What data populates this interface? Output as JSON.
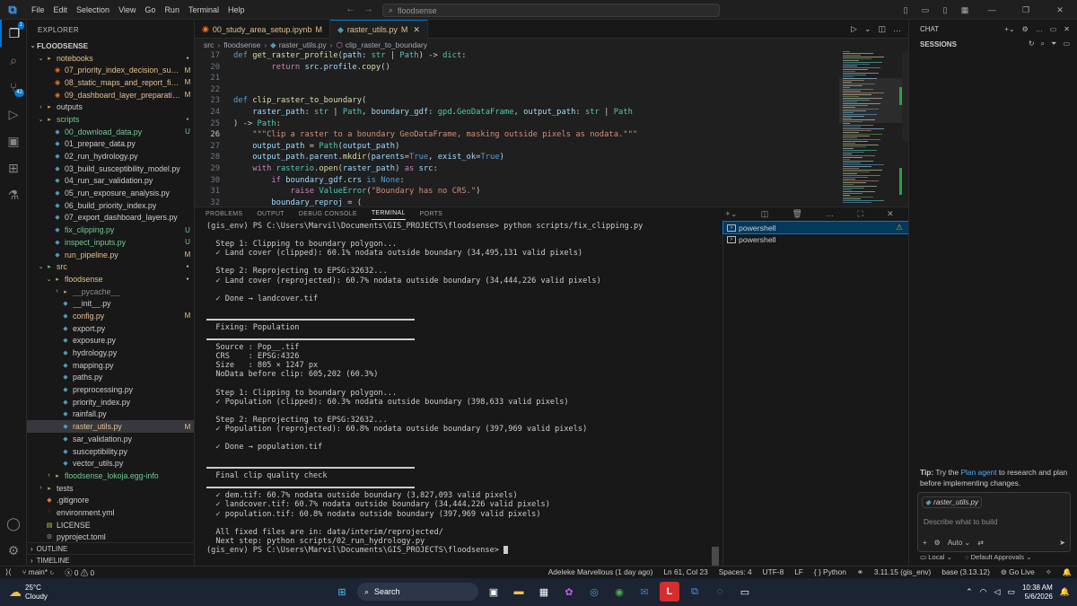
{
  "titlebar": {
    "menu": [
      "File",
      "Edit",
      "Selection",
      "View",
      "Go",
      "Run",
      "Terminal",
      "Help"
    ],
    "search_placeholder": "floodsense"
  },
  "explorer": {
    "header": "EXPLORER",
    "root": "FLOODSENSE",
    "items": [
      {
        "depth": 1,
        "chev": "⌄",
        "icon": "folder",
        "label": "notebooks",
        "status": "",
        "cls": "c-mod",
        "dot": true
      },
      {
        "depth": 2,
        "chev": "",
        "icon": "nb",
        "label": "07_priority_index_decision_suppor...",
        "status": "M",
        "cls": "c-mod"
      },
      {
        "depth": 2,
        "chev": "",
        "icon": "nb",
        "label": "08_static_maps_and_report_figure...",
        "status": "M",
        "cls": "c-mod"
      },
      {
        "depth": 2,
        "chev": "",
        "icon": "nb",
        "label": "09_dashboard_layer_preparation.i...",
        "status": "M",
        "cls": "c-mod"
      },
      {
        "depth": 1,
        "chev": "›",
        "icon": "folder",
        "label": "outputs",
        "status": "",
        "cls": "c-def"
      },
      {
        "depth": 1,
        "chev": "⌄",
        "icon": "folder",
        "label": "scripts",
        "status": "",
        "cls": "c-new",
        "dot": true
      },
      {
        "depth": 2,
        "chev": "",
        "icon": "py",
        "label": "00_download_data.py",
        "status": "U",
        "cls": "c-new"
      },
      {
        "depth": 2,
        "chev": "",
        "icon": "py",
        "label": "01_prepare_data.py",
        "status": "",
        "cls": "c-def"
      },
      {
        "depth": 2,
        "chev": "",
        "icon": "py",
        "label": "02_run_hydrology.py",
        "status": "",
        "cls": "c-def"
      },
      {
        "depth": 2,
        "chev": "",
        "icon": "py",
        "label": "03_build_susceptibility_model.py",
        "status": "",
        "cls": "c-def"
      },
      {
        "depth": 2,
        "chev": "",
        "icon": "py",
        "label": "04_run_sar_validation.py",
        "status": "",
        "cls": "c-def"
      },
      {
        "depth": 2,
        "chev": "",
        "icon": "py",
        "label": "05_run_exposure_analysis.py",
        "status": "",
        "cls": "c-def"
      },
      {
        "depth": 2,
        "chev": "",
        "icon": "py",
        "label": "06_build_priority_index.py",
        "status": "",
        "cls": "c-def"
      },
      {
        "depth": 2,
        "chev": "",
        "icon": "py",
        "label": "07_export_dashboard_layers.py",
        "status": "",
        "cls": "c-def"
      },
      {
        "depth": 2,
        "chev": "",
        "icon": "py",
        "label": "fix_clipping.py",
        "status": "U",
        "cls": "c-new"
      },
      {
        "depth": 2,
        "chev": "",
        "icon": "py",
        "label": "inspect_inputs.py",
        "status": "U",
        "cls": "c-new"
      },
      {
        "depth": 2,
        "chev": "",
        "icon": "py",
        "label": "run_pipeline.py",
        "status": "M",
        "cls": "c-mod"
      },
      {
        "depth": 1,
        "chev": "⌄",
        "icon": "src",
        "label": "src",
        "status": "",
        "cls": "c-mod",
        "dot": true
      },
      {
        "depth": 2,
        "chev": "⌄",
        "icon": "folder",
        "label": "floodsense",
        "status": "",
        "cls": "c-mod",
        "dot": true
      },
      {
        "depth": 3,
        "chev": "›",
        "icon": "folder",
        "label": "__pycache__",
        "status": "",
        "cls": "c-dim"
      },
      {
        "depth": 3,
        "chev": "",
        "icon": "py",
        "label": "__init__.py",
        "status": "",
        "cls": "c-def"
      },
      {
        "depth": 3,
        "chev": "",
        "icon": "py",
        "label": "config.py",
        "status": "M",
        "cls": "c-mod"
      },
      {
        "depth": 3,
        "chev": "",
        "icon": "py",
        "label": "export.py",
        "status": "",
        "cls": "c-def"
      },
      {
        "depth": 3,
        "chev": "",
        "icon": "py",
        "label": "exposure.py",
        "status": "",
        "cls": "c-def"
      },
      {
        "depth": 3,
        "chev": "",
        "icon": "py",
        "label": "hydrology.py",
        "status": "",
        "cls": "c-def"
      },
      {
        "depth": 3,
        "chev": "",
        "icon": "py",
        "label": "mapping.py",
        "status": "",
        "cls": "c-def"
      },
      {
        "depth": 3,
        "chev": "",
        "icon": "py",
        "label": "paths.py",
        "status": "",
        "cls": "c-def"
      },
      {
        "depth": 3,
        "chev": "",
        "icon": "py",
        "label": "preprocessing.py",
        "status": "",
        "cls": "c-def"
      },
      {
        "depth": 3,
        "chev": "",
        "icon": "py",
        "label": "priority_index.py",
        "status": "",
        "cls": "c-def"
      },
      {
        "depth": 3,
        "chev": "",
        "icon": "py",
        "label": "rainfall.py",
        "status": "",
        "cls": "c-def"
      },
      {
        "depth": 3,
        "chev": "",
        "icon": "py",
        "label": "raster_utils.py",
        "status": "M",
        "cls": "c-mod",
        "sel": true
      },
      {
        "depth": 3,
        "chev": "",
        "icon": "py",
        "label": "sar_validation.py",
        "status": "",
        "cls": "c-def"
      },
      {
        "depth": 3,
        "chev": "",
        "icon": "py",
        "label": "susceptibility.py",
        "status": "",
        "cls": "c-def"
      },
      {
        "depth": 3,
        "chev": "",
        "icon": "py",
        "label": "vector_utils.py",
        "status": "",
        "cls": "c-def"
      },
      {
        "depth": 2,
        "chev": "›",
        "icon": "folder",
        "label": "floodsense_lokoja.egg-info",
        "status": "",
        "cls": "c-new"
      },
      {
        "depth": 1,
        "chev": "›",
        "icon": "folder",
        "label": "tests",
        "status": "",
        "cls": "c-def"
      },
      {
        "depth": 1,
        "chev": "",
        "icon": "git",
        "label": ".gitignore",
        "status": "",
        "cls": "c-def"
      },
      {
        "depth": 1,
        "chev": "",
        "icon": "yml",
        "label": "environment.yml",
        "status": "",
        "cls": "c-def"
      },
      {
        "depth": 1,
        "chev": "",
        "icon": "lic",
        "label": "LICENSE",
        "status": "",
        "cls": "c-def"
      },
      {
        "depth": 1,
        "chev": "",
        "icon": "toml",
        "label": "pyproject.toml",
        "status": "",
        "cls": "c-def"
      }
    ],
    "outline": "OUTLINE",
    "timeline": "TIMELINE"
  },
  "editor": {
    "tabs": [
      {
        "label": "00_study_area_setup.ipynb",
        "mod": "M",
        "active": false
      },
      {
        "label": "raster_utils.py",
        "mod": "M",
        "active": true
      }
    ],
    "breadcrumb": [
      "src",
      "floodsense",
      "raster_utils.py",
      "clip_raster_to_boundary"
    ],
    "lines": [
      {
        "n": "17",
        "html": "<span class='kw'>def</span> <span class='fn'>get_raster_profile</span><span class='pl'>(</span><span class='var'>path</span><span class='pl'>: </span><span class='ty'>str</span><span class='pl'> | </span><span class='ty'>Path</span><span class='pl'>) -&gt; </span><span class='ty'>dict</span><span class='pl'>:</span>"
      },
      {
        "n": "20",
        "html": "        <span class='kw2'>return</span> <span class='var'>src</span><span class='pl'>.</span><span class='var'>profile</span><span class='pl'>.</span><span class='fn'>copy</span><span class='pl'>()</span>"
      },
      {
        "n": "21",
        "html": ""
      },
      {
        "n": "22",
        "html": ""
      },
      {
        "n": "23",
        "html": "<span class='kw'>def</span> <span class='fn'>clip_raster_to_boundary</span><span class='pl'>(</span>"
      },
      {
        "n": "24",
        "html": "    <span class='var'>raster_path</span><span class='pl'>: </span><span class='ty'>str</span><span class='pl'> | </span><span class='ty'>Path</span><span class='pl'>, </span><span class='var'>boundary_gdf</span><span class='pl'>: </span><span class='ty'>gpd</span><span class='pl'>.</span><span class='ty'>GeoDataFrame</span><span class='pl'>, </span><span class='var'>output_path</span><span class='pl'>: </span><span class='ty'>str</span><span class='pl'> | </span><span class='ty'>Path</span>"
      },
      {
        "n": "25",
        "html": "<span class='pl'>) -&gt; </span><span class='ty'>Path</span><span class='pl'>:</span>"
      },
      {
        "n": "26",
        "html": "    <span class='str'>\"\"\"Clip a raster to a boundary GeoDataFrame, masking outside pixels as nodata.\"\"\"</span>"
      },
      {
        "n": "27",
        "html": "    <span class='var'>output_path</span><span class='pl'> = </span><span class='ty'>Path</span><span class='pl'>(</span><span class='var'>output_path</span><span class='pl'>)</span>"
      },
      {
        "n": "28",
        "html": "    <span class='var'>output_path</span><span class='pl'>.</span><span class='var'>parent</span><span class='pl'>.</span><span class='fn'>mkdir</span><span class='pl'>(</span><span class='var'>parents</span><span class='pl'>=</span><span class='kw'>True</span><span class='pl'>, </span><span class='var'>exist_ok</span><span class='pl'>=</span><span class='kw'>True</span><span class='pl'>)</span>"
      },
      {
        "n": "29",
        "html": "    <span class='kw2'>with</span> <span class='ty'>rasterio</span><span class='pl'>.</span><span class='fn'>open</span><span class='pl'>(</span><span class='var'>raster_path</span><span class='pl'>) </span><span class='kw2'>as</span> <span class='var'>src</span><span class='pl'>:</span>"
      },
      {
        "n": "30",
        "html": "        <span class='kw2'>if</span> <span class='var'>boundary_gdf</span><span class='pl'>.</span><span class='var'>crs</span> <span class='kw'>is</span> <span class='kw'>None</span><span class='pl'>:</span>"
      },
      {
        "n": "31",
        "html": "            <span class='kw2'>raise</span> <span class='ty'>ValueError</span><span class='pl'>(</span><span class='str'>\"Boundary has no CRS.\"</span><span class='pl'>)</span>"
      },
      {
        "n": "32",
        "html": "        <span class='var'>boundary_reproj</span><span class='pl'> = (</span>"
      }
    ]
  },
  "panel": {
    "tabs": [
      "PROBLEMS",
      "OUTPUT",
      "DEBUG CONSOLE",
      "TERMINAL",
      "PORTS"
    ],
    "active_tab": "TERMINAL",
    "terminal_lines": [
      "(gis_env) PS C:\\Users\\Marvil\\Documents\\GIS_PROJECTS\\floodsense> python scripts/fix_clipping.py",
      "",
      "  Step 1: Clipping to boundary polygon...",
      "  ✓ Land cover (clipped): 60.1% nodata outside boundary (34,495,131 valid pixels)",
      "",
      "  Step 2: Reprojecting to EPSG:32632...",
      "  ✓ Land cover (reprojected): 60.7% nodata outside boundary (34,444,226 valid pixels)",
      "",
      "  ✓ Done → landcover.tif",
      "",
      "---",
      "  Fixing: Population",
      "---",
      "  Source : Pop__.tif",
      "  CRS    : EPSG:4326",
      "  Size   : 805 × 1247 px",
      "  NoData before clip: 605,202 (60.3%)",
      "",
      "  Step 1: Clipping to boundary polygon...",
      "  ✓ Population (clipped): 60.3% nodata outside boundary (398,633 valid pixels)",
      "",
      "  Step 2: Reprojecting to EPSG:32632...",
      "  ✓ Population (reprojected): 60.8% nodata outside boundary (397,969 valid pixels)",
      "",
      "  ✓ Done → population.tif",
      "",
      "---",
      "  Final clip quality check",
      "---",
      "  ✓ dem.tif: 60.7% nodata outside boundary (3,827,093 valid pixels)",
      "  ✓ landcover.tif: 60.7% nodata outside boundary (34,444,226 valid pixels)",
      "  ✓ population.tif: 60.8% nodata outside boundary (397,969 valid pixels)",
      "",
      "  All fixed files are in: data/interim/reprojected/",
      "  Next step: python scripts/02_run_hydrology.py"
    ],
    "prompt": "(gis_env) PS C:\\Users\\Marvil\\Documents\\GIS_PROJECTS\\floodsense> ",
    "terminals": [
      "powershell",
      "powershell"
    ]
  },
  "chat": {
    "title": "CHAT",
    "sessions": "SESSIONS",
    "tip_prefix": "Tip:",
    "tip_mid": " Try the ",
    "tip_link": "Plan agent",
    "tip_suffix": " to research and plan before implementing changes.",
    "attachment": "raster_utils.py",
    "placeholder": "Describe what to build",
    "mode": "Auto",
    "footer_local": "Local",
    "footer_approvals": "Default Approvals"
  },
  "statusbar": {
    "branch": "main*",
    "errors": "0",
    "warnings": "0",
    "blame": "Adeleke Marvellous (1 day ago)",
    "position": "Ln 61, Col 23",
    "spaces": "Spaces: 4",
    "encoding": "UTF-8",
    "eol": "LF",
    "language": "Python",
    "interpreter": "3.11.15 (gis_env)",
    "base": "base (3.13.12)",
    "golive": "Go Live"
  },
  "taskbar": {
    "temp": "25°C",
    "condition": "Cloudy",
    "search": "Search",
    "time": "10:38 AM",
    "date": "5/6/2026"
  }
}
